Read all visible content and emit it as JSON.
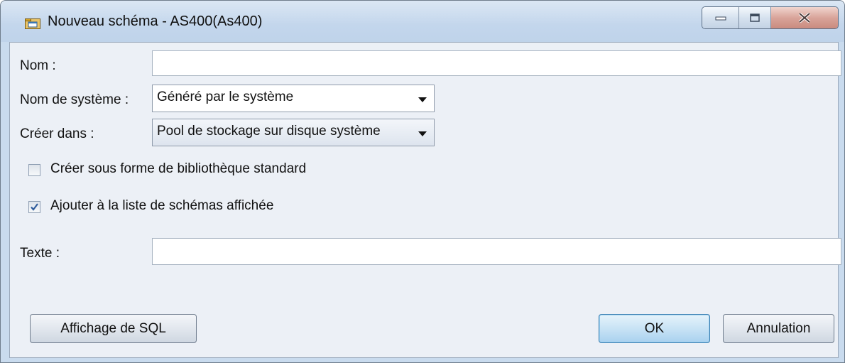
{
  "window": {
    "title": "Nouveau schéma - AS400(As400)"
  },
  "form": {
    "nom_label": "Nom :",
    "nom_value": "",
    "systeme_label": "Nom de système :",
    "systeme_value": "Généré par le système",
    "creer_label": "Créer dans :",
    "creer_value": "Pool de stockage sur disque système",
    "checkbox_standard_label": "Créer sous forme de bibliothèque standard",
    "checkbox_standard_checked": false,
    "checkbox_ajouter_label": "Ajouter à la liste de schémas affichée",
    "checkbox_ajouter_checked": true,
    "texte_label": "Texte :",
    "texte_value": ""
  },
  "buttons": {
    "sql": "Affichage de SQL",
    "ok": "OK",
    "cancel": "Annulation"
  },
  "icons": {
    "title": "schema-folder-icon",
    "minimize": "minimize-icon",
    "maximize": "maximize-icon",
    "close": "close-icon",
    "dropdown": "chevron-down-icon",
    "check": "checkmark-icon"
  }
}
